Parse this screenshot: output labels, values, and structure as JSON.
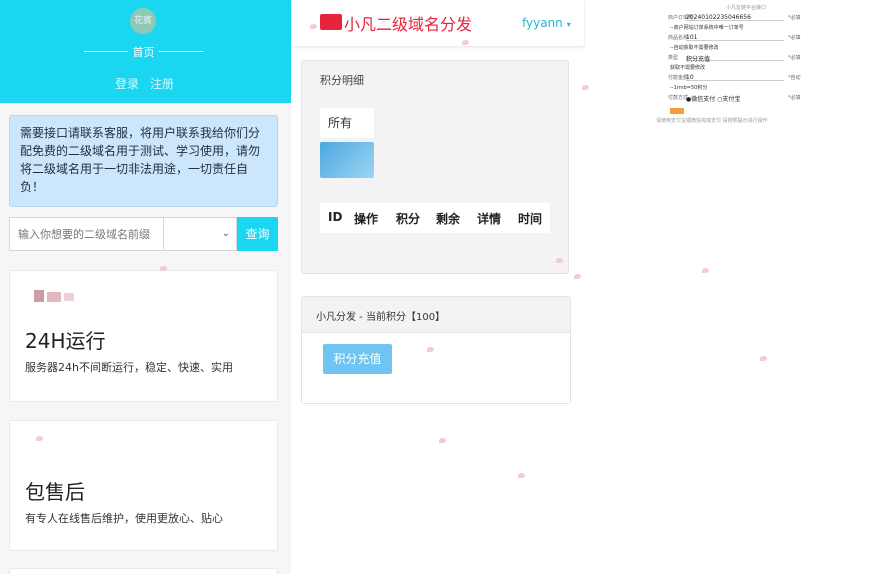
{
  "left": {
    "hero": {
      "avatar_text": "花賓",
      "title": "首页",
      "login": "登录",
      "register": "注册"
    },
    "notice": "需要接口请联系客服，将用户联系我给你们分配免费的二级域名用于测试、学习使用，请勿将二级域名用于一切非法用途，一切责任自负！",
    "search": {
      "placeholder": "输入你想要的二级域名前缀",
      "button": "查询"
    },
    "features": [
      {
        "title": "24H运行",
        "desc": "服务器24h不间断运行，稳定、快速、实用"
      },
      {
        "title": "包售后",
        "desc": "有专人在线售后维护，使用更放心、贴心"
      }
    ]
  },
  "mid": {
    "brand": "小凡二级域名分发",
    "user": "fyyann",
    "points_title": "积分明细",
    "filter": "所有",
    "table_headers": [
      "ID",
      "操作",
      "积分",
      "剩余",
      "详情",
      "时间"
    ],
    "balance_text": "小凡分发 - 当前积分【100】",
    "recharge_button": "积分充值"
  },
  "snippet": {
    "top": "小凡友链平台接口",
    "rows": [
      {
        "label": "商户订单号",
        "value": "20240102235046656",
        "req": "*必填"
      },
      {
        "hint": "--商户网站订单系统中唯一订单号"
      },
      {
        "label": "商品名称",
        "value": "101",
        "req": "*必填"
      },
      {
        "hint": "--自动获取不需要修改"
      },
      {
        "label": "类型",
        "value": "积分充值",
        "req": "*必填"
      },
      {
        "hint": "获取不需要修改"
      },
      {
        "label": "付款金额",
        "value": "10",
        "req": "*自动"
      },
      {
        "hint": "--1rmb=50积分"
      },
      {
        "label": "付款方式",
        "value": "●微信支付 ○支付宝",
        "req": "*必填"
      }
    ],
    "caption": "请使用支付宝或微信完成支付 请按照提示进行操作"
  }
}
